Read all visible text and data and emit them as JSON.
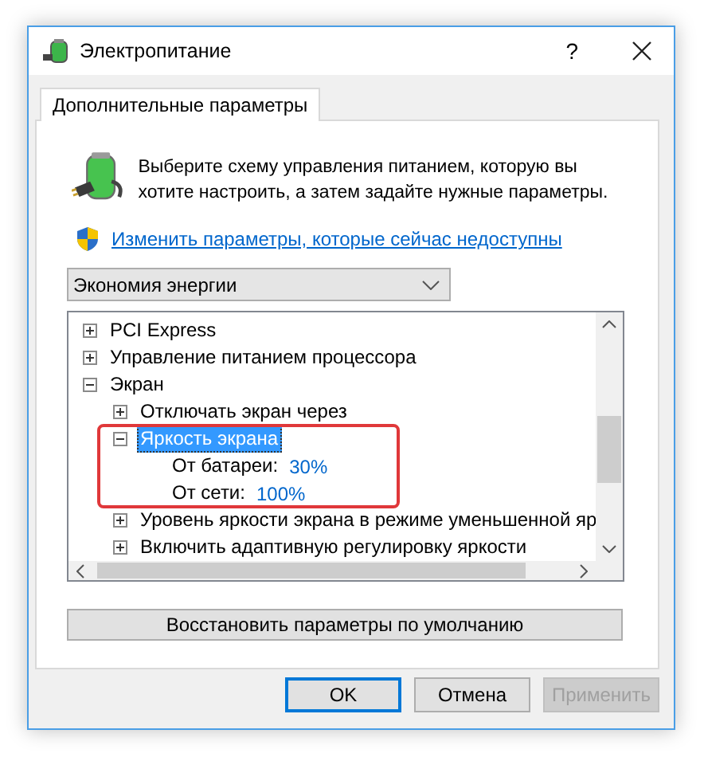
{
  "window": {
    "title": "Электропитание",
    "help": "?"
  },
  "tabs": [
    {
      "label": "Дополнительные параметры",
      "selected": true
    }
  ],
  "intro": "Выберите схему управления питанием, которую вы хотите настроить, а затем задайте нужные параметры.",
  "link": "Изменить параметры, которые сейчас недоступны",
  "plan_dropdown": {
    "value": "Экономия энергии"
  },
  "tree": [
    {
      "label": "PCI Express",
      "expanded": false,
      "selected": false,
      "highlighted": false
    },
    {
      "label": "Управление питанием процессора",
      "expanded": false,
      "selected": false,
      "highlighted": false
    },
    {
      "label": "Экран",
      "expanded": true,
      "selected": false,
      "highlighted": false,
      "children": [
        {
          "label": "Отключать экран через",
          "expanded": false,
          "selected": false,
          "highlighted": false
        },
        {
          "label": "Яркость экрана",
          "expanded": true,
          "selected": true,
          "highlighted": true,
          "children": [
            {
              "label": "От батареи:",
              "value": "30%"
            },
            {
              "label": "От сети:",
              "value": "100%"
            }
          ]
        },
        {
          "label": "Уровень яркости экрана в режиме уменьшенной яр",
          "expanded": false,
          "selected": false,
          "highlighted": false
        },
        {
          "label": "Включить адаптивную регулировку яркости",
          "expanded": false,
          "selected": false,
          "highlighted": false
        }
      ]
    }
  ],
  "reset_button": "Восстановить параметры по умолчанию",
  "buttons": [
    {
      "label": "OK",
      "focused": true,
      "disabled": false
    },
    {
      "label": "Отмена",
      "focused": false,
      "disabled": false
    },
    {
      "label": "Применить",
      "focused": false,
      "disabled": true
    }
  ]
}
